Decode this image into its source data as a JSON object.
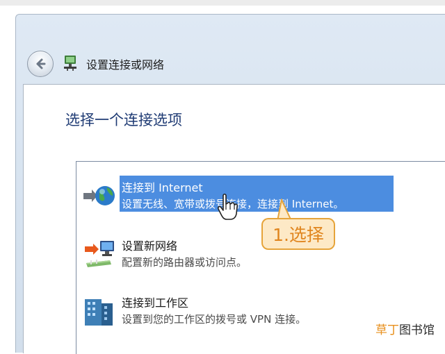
{
  "window": {
    "title": "设置连接或网络"
  },
  "page": {
    "title": "选择一个连接选项"
  },
  "options": [
    {
      "title": "连接到 Internet",
      "description": "设置无线、宽带或拨号连接，连接到 Internet。",
      "selected": true,
      "icon": "globe-network-icon"
    },
    {
      "title": "设置新网络",
      "description": "配置新的路由器或访问点。",
      "selected": false,
      "icon": "router-computer-icon"
    },
    {
      "title": "连接到工作区",
      "description": "设置到您的工作区的拨号或 VPN 连接。",
      "selected": false,
      "icon": "workplace-building-icon"
    }
  ],
  "callout": {
    "label": "1.选择"
  },
  "watermark": {
    "part1": "草丁",
    "part2": "图书馆"
  },
  "colors": {
    "selection": "#4c8de0",
    "callout_text": "#e0851e",
    "callout_border": "#e6a43a",
    "page_title": "#1f3b74"
  }
}
